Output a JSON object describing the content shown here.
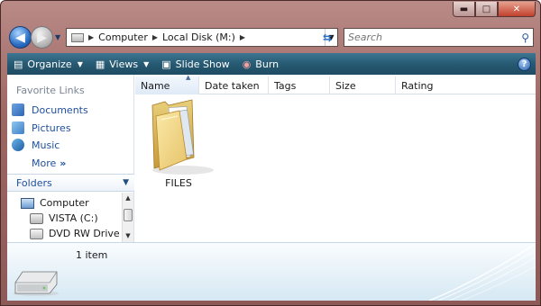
{
  "window": {
    "controls": {
      "minimize": "▬",
      "maximize": "□",
      "close": "✕"
    }
  },
  "address": {
    "segments": [
      "Computer",
      "Local Disk (M:)"
    ],
    "search_placeholder": "Search"
  },
  "toolbar": {
    "organize": "Organize",
    "views": "Views",
    "slideshow": "Slide Show",
    "burn": "Burn",
    "help": "?"
  },
  "nav_pane": {
    "favorites_header": "Favorite Links",
    "favorites": [
      "Documents",
      "Pictures",
      "Music"
    ],
    "more": "More",
    "more_glyph": "»",
    "folders_label": "Folders",
    "tree": [
      "Computer",
      "VISTA (C:)",
      "DVD RW Drive (D"
    ]
  },
  "columns": [
    "Name",
    "Date taken",
    "Tags",
    "Size",
    "Rating"
  ],
  "files": [
    {
      "name": "FILES",
      "icon": "folder-icon"
    }
  ],
  "details": {
    "count": "1 item"
  },
  "colors": {
    "frame": "#9c6662",
    "toolbar": "#275a73",
    "link": "#1e4f9c"
  }
}
